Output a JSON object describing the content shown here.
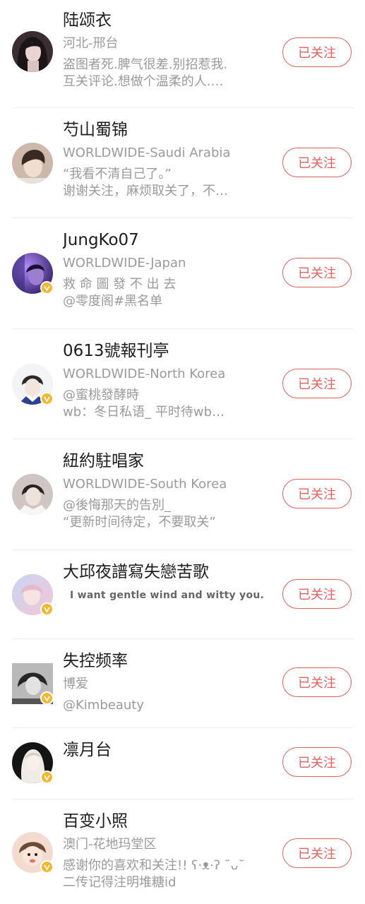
{
  "colors": {
    "accent": "#e2615f",
    "verified": "#f2b72e",
    "secondary_text": "#9a9a9a",
    "divider": "#ececec"
  },
  "follow_label": "已关注",
  "users": [
    {
      "name": "陆颂衣",
      "location": "河北-邢台",
      "bio1": "盗图者死.脾气很差.别招惹我.",
      "bio2": "互关评论.想做个温柔的人.…",
      "verified": false,
      "avatar": "person-avatar-dark-hair"
    },
    {
      "name": "芍山蜀锦",
      "location": "WORLDWIDE-Saudi Arabia",
      "bio1": "“我看不清自己了。”",
      "bio2": "谢谢关注，麻烦取关了，不…",
      "verified": false,
      "avatar": "person-avatar-boy"
    },
    {
      "name": "JungKo07",
      "location": "WORLDWIDE-Japan",
      "bio1": " 救 命 圖 發 不 出 去",
      "bio2": " @零度阁#黑名单",
      "verified": true,
      "avatar": "person-avatar-purple-light"
    },
    {
      "name": "0613號報刊亭",
      "location": "WORLDWIDE-North Korea",
      "bio1": "@蜜桃發酵時",
      "bio2": " wb：冬日私语_  平时待wb…",
      "verified": true,
      "avatar": "person-avatar-sailor"
    },
    {
      "name": "紐約駐唱家",
      "location": "WORLDWIDE-South Korea",
      "bio1": "@後悔那天的告別_",
      "bio2": "  “更新时间待定，不要取关”",
      "verified": false,
      "avatar": "person-avatar-light-coat"
    },
    {
      "name": "大邱夜譜寫失戀苦歌",
      "location": "",
      "bio1": "I want gentle wind and witty you.",
      "bio2": "",
      "verified": true,
      "avatar": "person-avatar-pastel"
    },
    {
      "name": "失控频率",
      "location": "博爱",
      "bio1": "@Kimbeauty",
      "bio2": "",
      "verified": true,
      "avatar": "person-avatar-grayscale"
    },
    {
      "name": "凛月台",
      "location": "",
      "bio1": "",
      "bio2": "",
      "verified": true,
      "avatar": "person-avatar-long-hair"
    },
    {
      "name": "百变小照",
      "location": "澳门-花地玛堂区",
      "bio1": "感谢你的喜欢和关注!! ʕ·ᴥ·ʔ ˘ᴗ˘",
      "bio2": "二传记得注明堆糖id",
      "verified": true,
      "avatar": "baby-avatar"
    }
  ]
}
